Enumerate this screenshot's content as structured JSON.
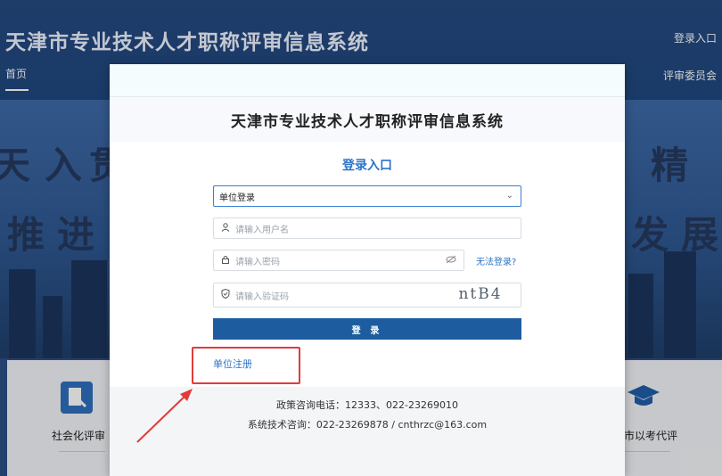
{
  "header": {
    "site_title": "天津市专业技术人才职称评审信息系统",
    "login_link": "登录入口"
  },
  "nav": {
    "home": "首页",
    "reviewer": "评审委员会"
  },
  "banner": {
    "slogan_top": [
      "入",
      "贯",
      "精"
    ],
    "slogan_bottom": [
      "推",
      "进",
      "发",
      "展"
    ]
  },
  "cards": {
    "left_label": "社会化评审",
    "right_label": "市以考代评"
  },
  "modal": {
    "title": "天津市专业技术人才职称评审信息系统",
    "heading": "登录入口",
    "login_type": {
      "selected": "单位登录",
      "icon": "chevron-down-icon"
    },
    "username": {
      "placeholder": "请输入用户名",
      "icon": "user-icon"
    },
    "password": {
      "placeholder": "请输入密码",
      "icon": "lock-icon",
      "toggle_icon": "eye-off-icon"
    },
    "forgot_link": "无法登录?",
    "captcha": {
      "placeholder": "请输入验证码",
      "icon": "shield-icon",
      "image_text": "ntB4"
    },
    "login_button": "登 录",
    "register_link": "单位注册",
    "footer": {
      "policy": "政策咨询电话：12333、022-23269010",
      "tech": "系统技术咨询：022-23269878 / cnthrzc@163.com"
    }
  },
  "colors": {
    "accent": "#2c74c9",
    "button": "#1d5d9f",
    "annotation": "#e23b3b"
  }
}
